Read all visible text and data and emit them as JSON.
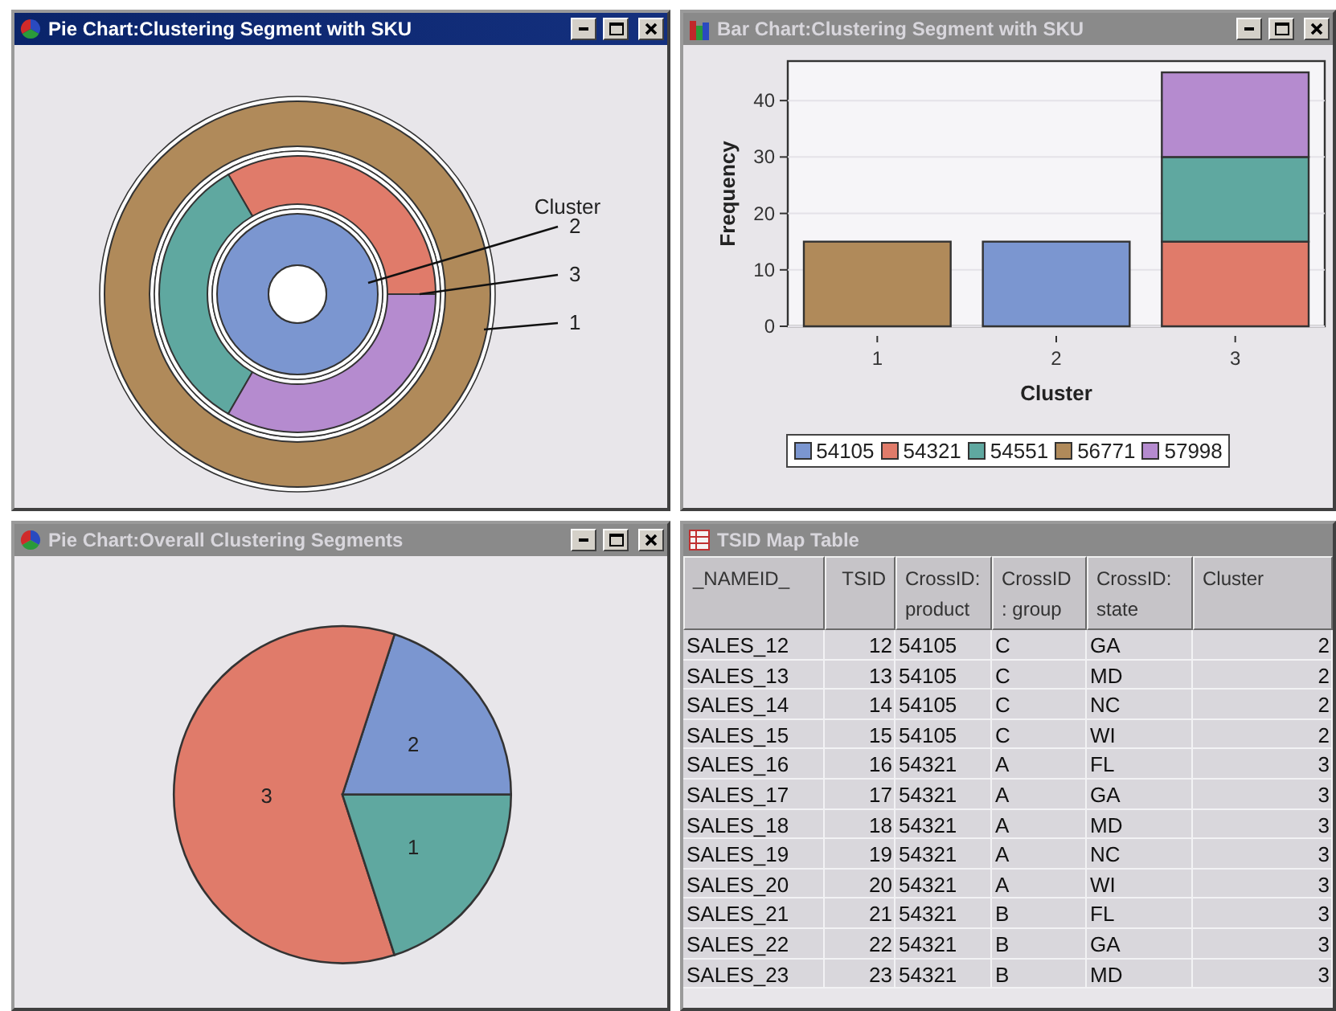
{
  "donut_window": {
    "title": "Pie Chart:Clustering Segment with SKU",
    "active": true,
    "legend_title": "Cluster",
    "rings": [
      {
        "label": "2",
        "segments": [
          {
            "color": "#7b96d0"
          }
        ]
      },
      {
        "label": "3",
        "segments": [
          {
            "color": "#e07b6a"
          },
          {
            "color": "#5fa8a0"
          },
          {
            "color": "#b58bcf"
          }
        ]
      },
      {
        "label": "1",
        "segments": [
          {
            "color": "#b08a5a"
          }
        ]
      }
    ]
  },
  "bar_window": {
    "title": "Bar Chart:Clustering Segment with SKU",
    "active": false,
    "chart_data": {
      "type": "bar",
      "xlabel": "Cluster",
      "ylabel": "Frequency",
      "categories": [
        "1",
        "2",
        "3"
      ],
      "stacked": true,
      "grid": true,
      "ylim": [
        0,
        47
      ],
      "yticks": [
        0,
        10,
        20,
        30,
        40
      ],
      "series": [
        {
          "name": "54105",
          "color": "#7b96d0",
          "values": [
            0,
            15,
            0
          ]
        },
        {
          "name": "54321",
          "color": "#e07b6a",
          "values": [
            0,
            0,
            15
          ]
        },
        {
          "name": "54551",
          "color": "#5fa8a0",
          "values": [
            0,
            0,
            15
          ]
        },
        {
          "name": "56771",
          "color": "#b08a5a",
          "values": [
            15,
            0,
            0
          ]
        },
        {
          "name": "57998",
          "color": "#b58bcf",
          "values": [
            0,
            0,
            15
          ]
        }
      ]
    }
  },
  "pie_window": {
    "title": "Pie Chart:Overall Clustering Segments",
    "active": false,
    "chart_data": {
      "type": "pie",
      "categories": [
        "2",
        "3",
        "1"
      ],
      "values": [
        20,
        60,
        20
      ],
      "colors": [
        "#7b96d0",
        "#e07b6a",
        "#5fa8a0"
      ]
    }
  },
  "table_window": {
    "title": "TSID Map Table",
    "active": false,
    "columns": [
      "_NAMEID_",
      "TSID",
      "CrossID:\nproduct",
      "CrossID\n: group",
      "CrossID:\nstate",
      "Cluster"
    ],
    "rows": [
      [
        "SALES_12",
        "12",
        "54105",
        "C",
        "GA",
        "2"
      ],
      [
        "SALES_13",
        "13",
        "54105",
        "C",
        "MD",
        "2"
      ],
      [
        "SALES_14",
        "14",
        "54105",
        "C",
        "NC",
        "2"
      ],
      [
        "SALES_15",
        "15",
        "54105",
        "C",
        "WI",
        "2"
      ],
      [
        "SALES_16",
        "16",
        "54321",
        "A",
        "FL",
        "3"
      ],
      [
        "SALES_17",
        "17",
        "54321",
        "A",
        "GA",
        "3"
      ],
      [
        "SALES_18",
        "18",
        "54321",
        "A",
        "MD",
        "3"
      ],
      [
        "SALES_19",
        "19",
        "54321",
        "A",
        "NC",
        "3"
      ],
      [
        "SALES_20",
        "20",
        "54321",
        "A",
        "WI",
        "3"
      ],
      [
        "SALES_21",
        "21",
        "54321",
        "B",
        "FL",
        "3"
      ],
      [
        "SALES_22",
        "22",
        "54321",
        "B",
        "GA",
        "3"
      ],
      [
        "SALES_23",
        "23",
        "54321",
        "B",
        "MD",
        "3"
      ]
    ]
  }
}
